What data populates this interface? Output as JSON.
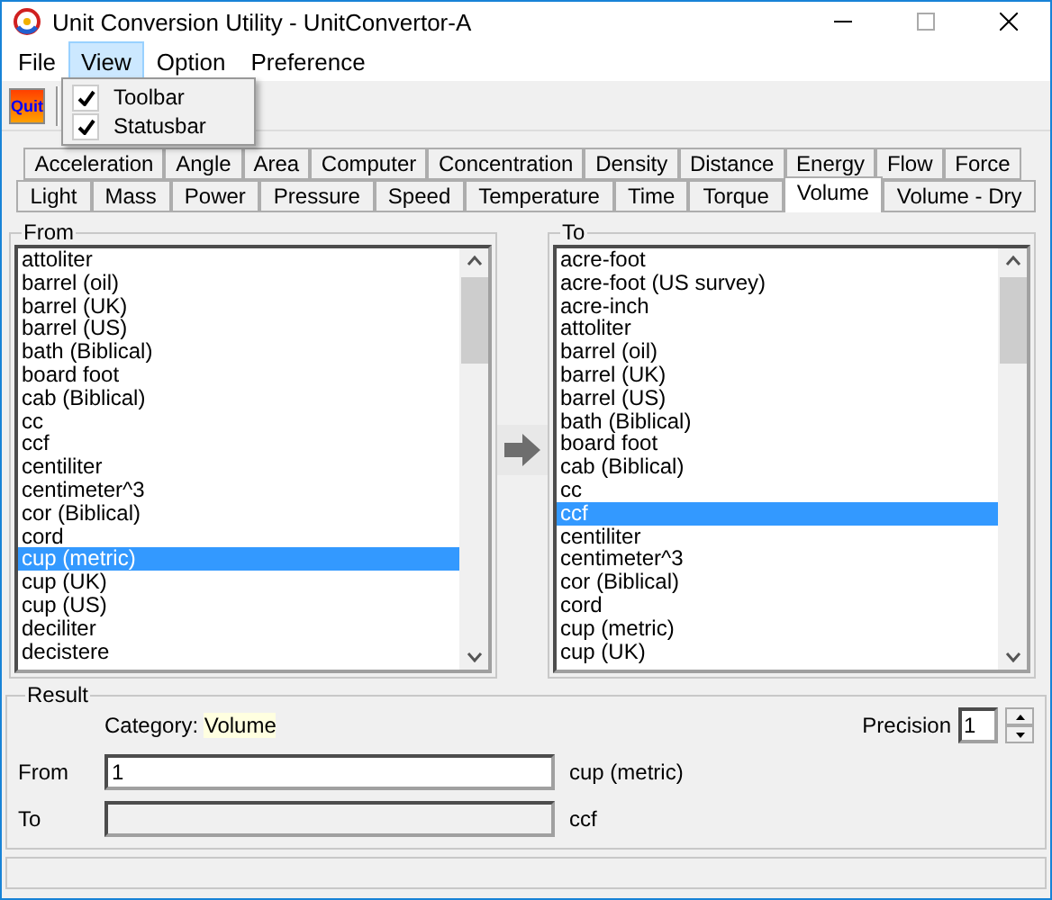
{
  "window": {
    "title": "Unit Conversion Utility - UnitConvertor-A"
  },
  "menu": [
    {
      "label": "File",
      "selected": false
    },
    {
      "label": "View",
      "selected": true
    },
    {
      "label": "Option",
      "selected": false
    },
    {
      "label": "Preference",
      "selected": false
    }
  ],
  "view_menu": [
    {
      "label": "Toolbar",
      "checked": true
    },
    {
      "label": "Statusbar",
      "checked": true
    }
  ],
  "toolbar": {
    "quit_button": "Quit"
  },
  "tab_rows": [
    [
      {
        "label": "Acceleration",
        "selected": false
      },
      {
        "label": "Angle",
        "selected": false
      },
      {
        "label": "Area",
        "selected": false
      },
      {
        "label": "Computer",
        "selected": false
      },
      {
        "label": "Concentration",
        "selected": false
      },
      {
        "label": "Density",
        "selected": false
      },
      {
        "label": "Distance",
        "selected": false
      },
      {
        "label": "Energy",
        "selected": false
      },
      {
        "label": "Flow",
        "selected": false
      },
      {
        "label": "Force",
        "selected": false
      }
    ],
    [
      {
        "label": "Light",
        "selected": false
      },
      {
        "label": "Mass",
        "selected": false
      },
      {
        "label": "Power",
        "selected": false
      },
      {
        "label": "Pressure",
        "selected": false
      },
      {
        "label": "Speed",
        "selected": false
      },
      {
        "label": "Temperature",
        "selected": false
      },
      {
        "label": "Time",
        "selected": false
      },
      {
        "label": "Torque",
        "selected": false
      },
      {
        "label": "Volume",
        "selected": true
      },
      {
        "label": "Volume - Dry",
        "selected": false
      }
    ]
  ],
  "from_list": {
    "title": "From",
    "items": [
      {
        "label": "attoliter",
        "selected": false
      },
      {
        "label": "barrel (oil)",
        "selected": false
      },
      {
        "label": "barrel (UK)",
        "selected": false
      },
      {
        "label": "barrel (US)",
        "selected": false
      },
      {
        "label": "bath (Biblical)",
        "selected": false
      },
      {
        "label": "board foot",
        "selected": false
      },
      {
        "label": "cab (Biblical)",
        "selected": false
      },
      {
        "label": "cc",
        "selected": false
      },
      {
        "label": "ccf",
        "selected": false
      },
      {
        "label": "centiliter",
        "selected": false
      },
      {
        "label": "centimeter^3",
        "selected": false
      },
      {
        "label": "cor (Biblical)",
        "selected": false
      },
      {
        "label": "cord",
        "selected": false
      },
      {
        "label": "cup (metric)",
        "selected": true
      },
      {
        "label": "cup (UK)",
        "selected": false
      },
      {
        "label": "cup (US)",
        "selected": false
      },
      {
        "label": "deciliter",
        "selected": false
      },
      {
        "label": "decistere",
        "selected": false
      }
    ]
  },
  "to_list": {
    "title": "To",
    "items": [
      {
        "label": "acre-foot",
        "selected": false
      },
      {
        "label": "acre-foot (US survey)",
        "selected": false
      },
      {
        "label": "acre-inch",
        "selected": false
      },
      {
        "label": "attoliter",
        "selected": false
      },
      {
        "label": "barrel (oil)",
        "selected": false
      },
      {
        "label": "barrel (UK)",
        "selected": false
      },
      {
        "label": "barrel (US)",
        "selected": false
      },
      {
        "label": "bath (Biblical)",
        "selected": false
      },
      {
        "label": "board foot",
        "selected": false
      },
      {
        "label": "cab (Biblical)",
        "selected": false
      },
      {
        "label": "cc",
        "selected": false
      },
      {
        "label": "ccf",
        "selected": true
      },
      {
        "label": "centiliter",
        "selected": false
      },
      {
        "label": "centimeter^3",
        "selected": false
      },
      {
        "label": "cor (Biblical)",
        "selected": false
      },
      {
        "label": "cord",
        "selected": false
      },
      {
        "label": "cup (metric)",
        "selected": false
      },
      {
        "label": "cup (UK)",
        "selected": false
      }
    ]
  },
  "result": {
    "title": "Result",
    "category_label": "Category:",
    "category_value": "Volume",
    "precision_label": "Precision",
    "precision_value": "1",
    "from_label": "From",
    "from_value": "1",
    "from_unit": "cup (metric)",
    "to_label": "To",
    "to_unit": "ccf"
  }
}
